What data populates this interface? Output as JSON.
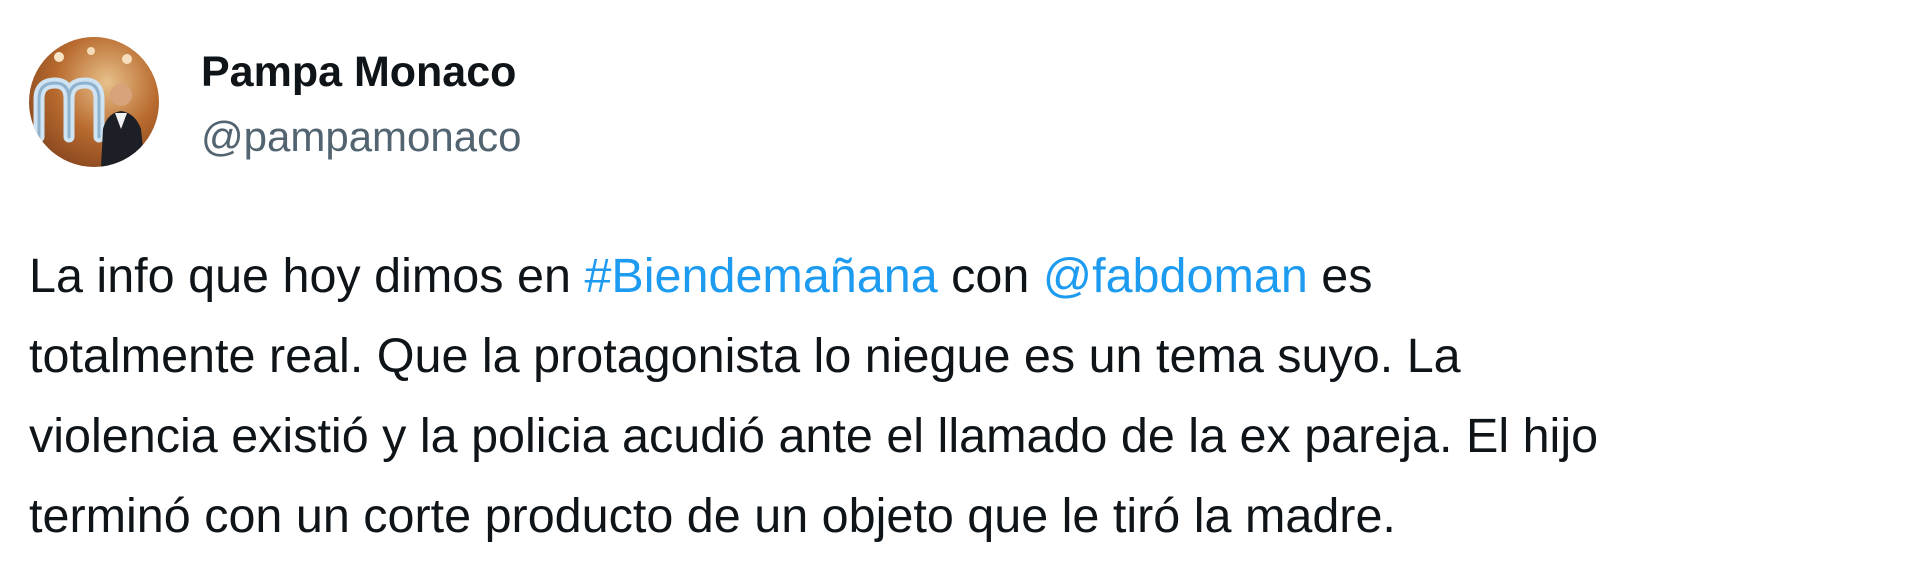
{
  "author": {
    "display_name": "Pampa Monaco",
    "handle": "@pampamonaco",
    "avatar_icon": "profile-photo-avatar"
  },
  "tweet": {
    "line1_part1": "La info que hoy dimos en ",
    "hashtag": "#Biendemañana",
    "line1_part2": " con ",
    "mention": "@fabdoman",
    "line1_part3": " es",
    "line2": "totalmente real. Que la protagonista lo niegue es un tema suyo. La",
    "line3": "violencia existió y la policia acudió ante el llamado de la ex pareja. El hijo",
    "line4": "terminó con un corte producto de un objeto que le tiró la madre."
  },
  "colors": {
    "text": "#0f1419",
    "secondary_text": "#536471",
    "link": "#1d9bf0"
  }
}
